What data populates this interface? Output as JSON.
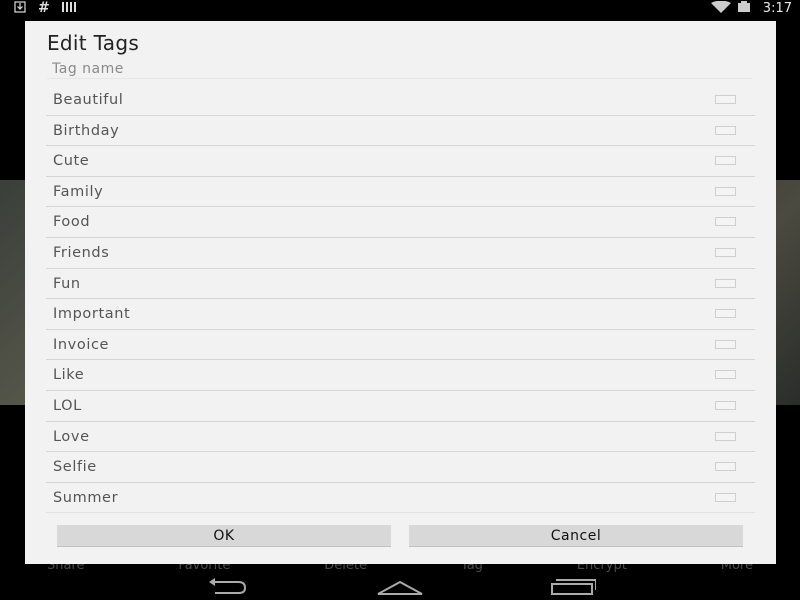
{
  "statusbar": {
    "clock": "3:17"
  },
  "background_actions": [
    "Share",
    "Favorite",
    "Delete",
    "Tag",
    "Encrypt",
    "More"
  ],
  "dialog": {
    "title": "Edit Tags",
    "input_placeholder": "Tag name",
    "tags": [
      {
        "label": "Beautiful",
        "checked": false
      },
      {
        "label": "Birthday",
        "checked": false
      },
      {
        "label": "Cute",
        "checked": false
      },
      {
        "label": "Family",
        "checked": false
      },
      {
        "label": "Food",
        "checked": false
      },
      {
        "label": "Friends",
        "checked": false
      },
      {
        "label": "Fun",
        "checked": false
      },
      {
        "label": "Important",
        "checked": false
      },
      {
        "label": "Invoice",
        "checked": false
      },
      {
        "label": "Like",
        "checked": false
      },
      {
        "label": "LOL",
        "checked": false
      },
      {
        "label": "Love",
        "checked": false
      },
      {
        "label": "Selfie",
        "checked": false
      },
      {
        "label": "Summer",
        "checked": false
      }
    ],
    "ok_label": "OK",
    "cancel_label": "Cancel"
  },
  "icons": {
    "status_left": [
      "download-icon",
      "hash-icon",
      "signal-bars-icon"
    ],
    "status_right": [
      "wifi-icon",
      "battery-icon"
    ],
    "nav": [
      "back-icon",
      "home-icon",
      "recents-icon"
    ]
  }
}
